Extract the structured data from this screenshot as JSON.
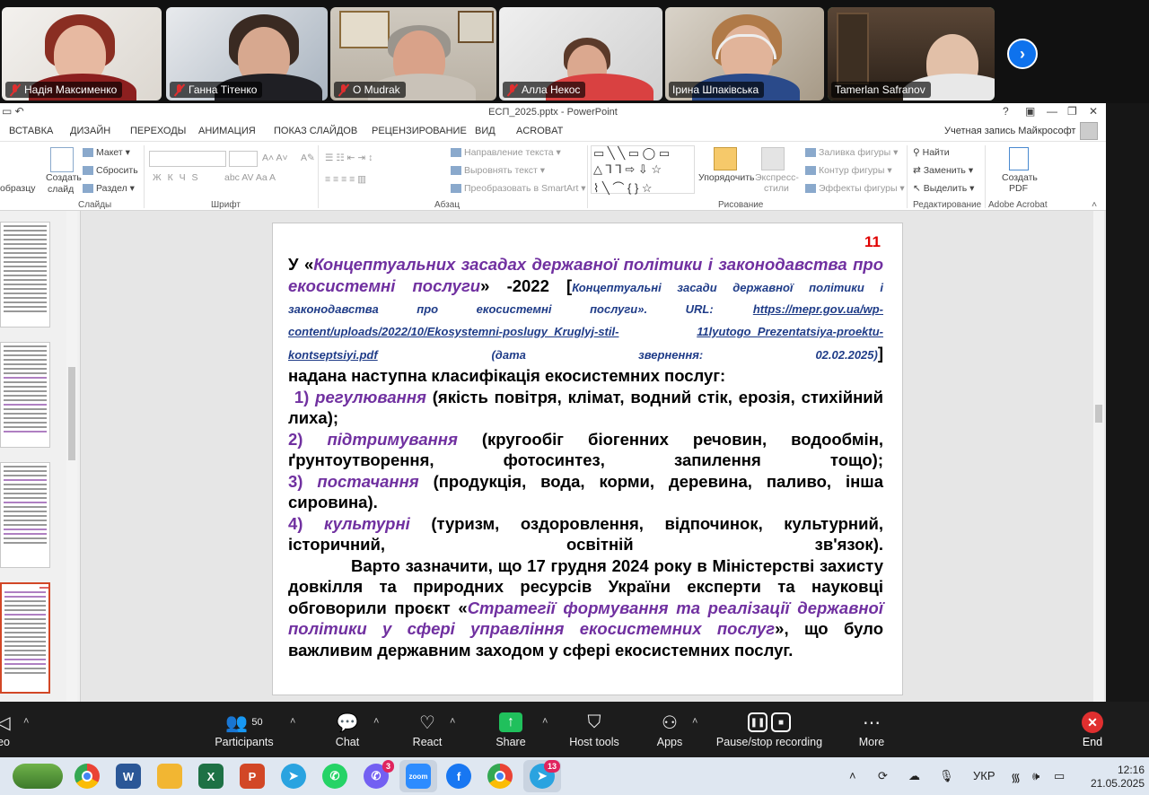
{
  "participants": [
    {
      "name": "Надія Максименко",
      "muted": true
    },
    {
      "name": "Ганна Тітенко",
      "muted": true
    },
    {
      "name": "O Mudrak",
      "muted": true
    },
    {
      "name": "Алла Некос",
      "muted": true
    },
    {
      "name": "Ірина Шпаківська",
      "muted": false
    },
    {
      "name": "Tamerlan Safranov",
      "muted": false,
      "active": true
    }
  ],
  "window": {
    "title": "ЕСП_2025.pptx - PowerPoint",
    "account": "Учетная запись Майкрософт"
  },
  "tabs": [
    "ВСТАВКА",
    "ДИЗАЙН",
    "ПЕРЕХОДЫ",
    "АНИМАЦИЯ",
    "ПОКАЗ СЛАЙДОВ",
    "РЕЦЕНЗИРОВАНИЕ",
    "ВИД",
    "ACROBAT"
  ],
  "ribbon": {
    "paste_format": "образцу",
    "new_slide": "Создать",
    "new_slide_2": "слайд",
    "layout": "Макет",
    "reset": "Сбросить",
    "section": "Раздел",
    "group_slides": "Слайды",
    "group_font": "Шрифт",
    "font_buttons": "Ж  К  Ч  S",
    "text_direction": "Направление текста",
    "align_text": "Выровнять текст",
    "smartart": "Преобразовать в SmartArt",
    "group_paragraph": "Абзац",
    "arrange": "Упорядочить",
    "quick_styles": "Экспресс-",
    "quick_styles_2": "стили",
    "shape_fill": "Заливка фигуры",
    "shape_outline": "Контур фигуры",
    "shape_effects": "Эффекты фигуры",
    "group_drawing": "Рисование",
    "find": "Найти",
    "replace": "Заменить",
    "select": "Выделить",
    "group_editing": "Редактирование",
    "create_pdf": "Создать",
    "create_pdf_2": "PDF",
    "group_acrobat": "Adobe Acrobat"
  },
  "slide": {
    "number": "11",
    "intro_1": "У «",
    "doc_title": "Концептуальних засадах державної політики і законодавства про екосистемні послуги",
    "intro_2": "» -2022 [",
    "ref_text": "Концептуальні засади державної політики і законодавства про екосистемні послуги». URL:",
    "url_1": "https://mepr.gov.ua/wp-content/uploads/2022/10/Ekosystemni-poslugy_Kruglyj-stil-",
    "url_2": "11lyutogo_Prezentatsiya-proektu-kontseptsiyi.pdf",
    "access_date": "(дата звернення: 02.02.2025)",
    "bracket_close": "]",
    "lead": "надана наступна класифікація екосистемних послуг:",
    "items": [
      {
        "num": "1)",
        "term": "регулювання",
        "desc": "(якість повітря, клімат, водний стік, ерозія, стихійний лиха);"
      },
      {
        "num": "2)",
        "term": "підтримування",
        "desc": "(кругообіг біогенних речовин, водообмін, ґрунтоутворення, фотосинтез, запилення тощо);"
      },
      {
        "num": "3)",
        "term": "постачання",
        "desc": "(продукція, вода, корми, деревина, паливо, інша сировина)."
      },
      {
        "num": "4)",
        "term": "культурні",
        "desc": "(туризм, оздоровлення, відпочинок, культурний, історичний, освітній зв'язок)."
      }
    ],
    "para_1": "Варто зазначити, що 17 грудня 2024 року в Міністерстві захисту довкілля та природних ресурсів України експерти та науковці обговорили проєкт «",
    "strategy": "Стратегії формування та реалізації державної політики у сфері управління екосистемних послуг",
    "para_2": "», що було важливим державним заходом у сфері екосистемних послуг."
  },
  "toolbar": {
    "participants_label": "Participants",
    "participants_count": "50",
    "chat": "Chat",
    "react": "React",
    "share": "Share",
    "host_tools": "Host tools",
    "apps": "Apps",
    "recording": "Pause/stop recording",
    "more": "More",
    "end": "End",
    "left_partial": "eo"
  },
  "taskbar": {
    "viber_badge": "3",
    "telegram_badge": "13",
    "lang": "УКР",
    "time": "12:16",
    "date": "21.05.2025",
    "zoom_label": "zoom",
    "word_letter": "W",
    "excel_letter": "X",
    "ppt_letter": "P"
  },
  "colors": {
    "accent_purple": "#7030a0",
    "slide_number_red": "#e00000",
    "zoom_green": "#35d27a",
    "end_red": "#e02f2f"
  }
}
